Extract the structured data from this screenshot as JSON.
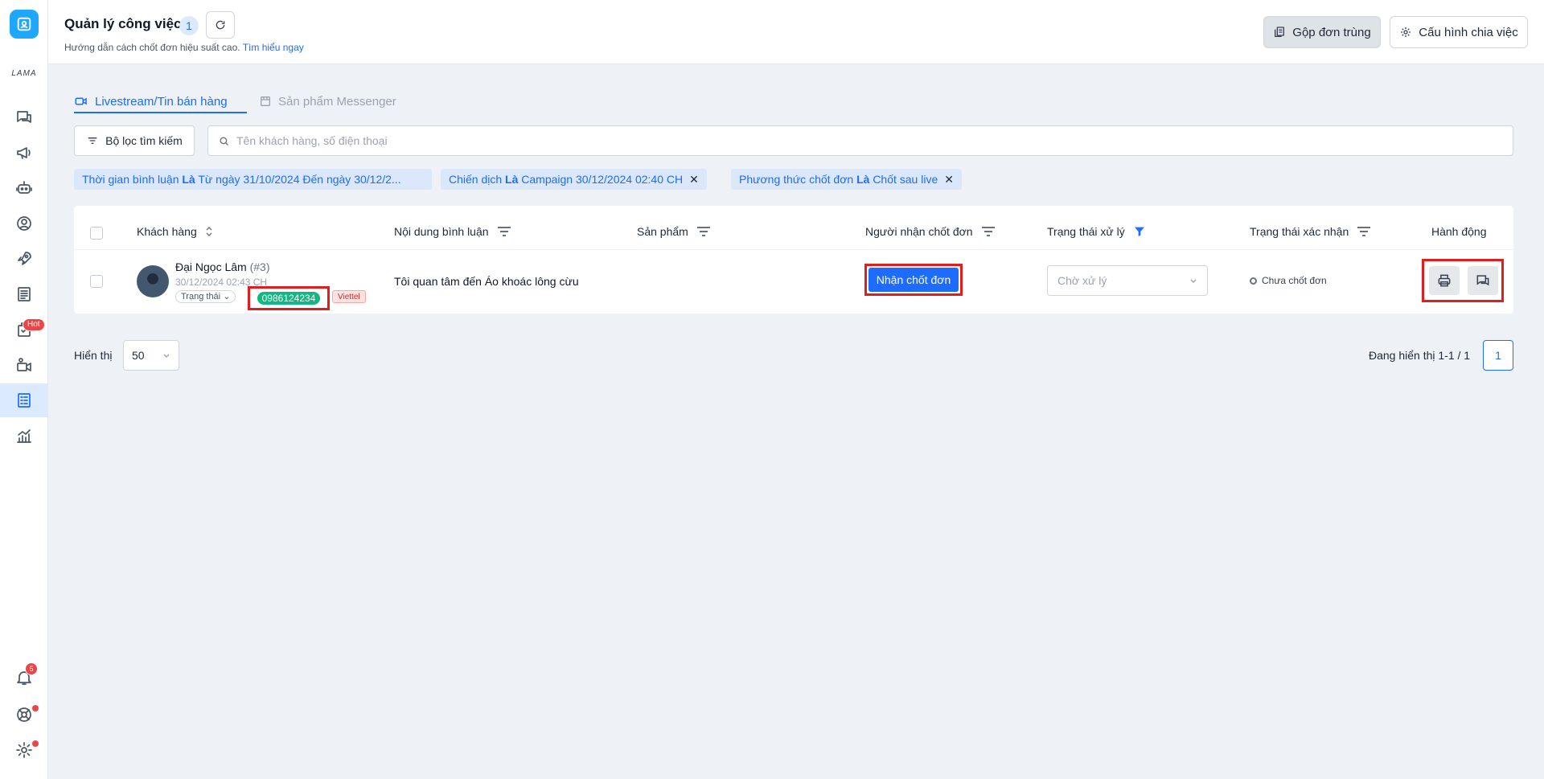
{
  "sidebar": {
    "brand_text": "LAMA",
    "hot_badge": "Hot",
    "notif_count": "5",
    "items": [
      "chat",
      "megaphone",
      "bot",
      "user-circle",
      "rocket",
      "document",
      "orders",
      "livestream",
      "task-manager",
      "analytics"
    ]
  },
  "header": {
    "title": "Quản lý công việc",
    "count": "1",
    "subtitle": "Hướng dẫn cách chốt đơn hiệu suất cao.",
    "subtitle_link": "Tìm hiểu ngay",
    "merge_button": "Gộp đơn trùng",
    "config_button": "Cấu hình chia việc"
  },
  "tabs": [
    {
      "label": "Livestream/Tin bán hàng",
      "active": true
    },
    {
      "label": "Sản phẩm Messenger",
      "active": false
    }
  ],
  "filter": {
    "button_label": "Bộ lọc tìm kiếm",
    "search_placeholder": "Tên khách hàng, số điện thoại"
  },
  "chips": [
    {
      "field": "Thời gian bình luận",
      "op": "Là",
      "value": "Từ ngày 31/10/2024 Đến ngày 30/12/2..."
    },
    {
      "field": "Chiến dịch",
      "op": "Là",
      "value": "Campaign 30/12/2024 02:40 CH"
    },
    {
      "field": "Phương thức chốt đơn",
      "op": "Là",
      "value": "Chốt sau live"
    }
  ],
  "table": {
    "headers": [
      "Khách hàng",
      "Nội dung bình luận",
      "Sản phẩm",
      "Người nhận chốt đơn",
      "Trạng thái xử lý",
      "Trạng thái xác nhận",
      "Hành động"
    ],
    "rows": [
      {
        "customer_name": "Đại Ngọc Lâm",
        "customer_id": "(#3)",
        "date": "30/12/2024 02:43 CH",
        "status": "Trạng thái",
        "phone": "0986124234",
        "carrier": "Viettel",
        "comment": "Tôi quan tâm đến Áo khoác lông cừu",
        "product": "",
        "claim_button": "Nhận chốt đơn",
        "process_placeholder": "Chờ xử lý",
        "confirm_status": "Chưa chốt đơn"
      }
    ]
  },
  "footer": {
    "show_label": "Hiển thị",
    "page_size": "50",
    "page_info": "Đang hiển thị 1-1 / 1",
    "current_page": "1"
  },
  "colors": {
    "accent": "#1d6bff",
    "highlight": "#e11d1d",
    "phone_green": "#10b981"
  }
}
